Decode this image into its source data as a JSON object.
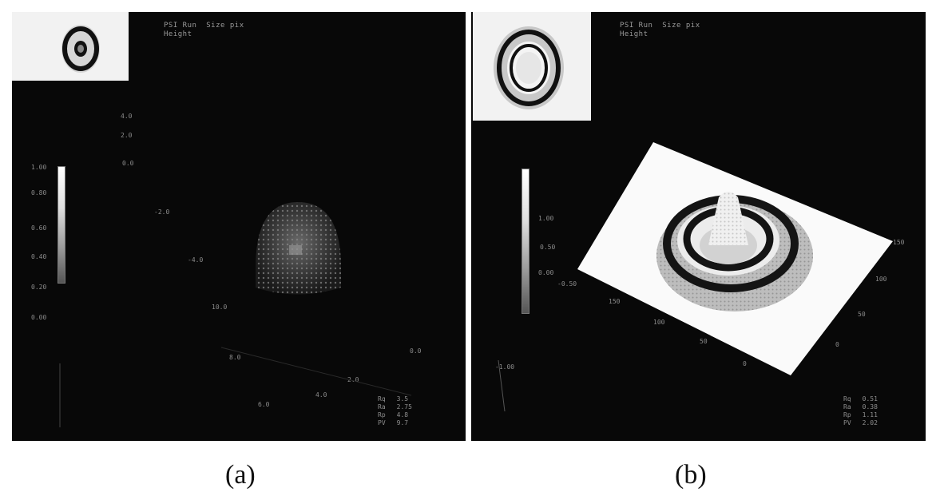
{
  "captions": {
    "a": "(a)",
    "b": "(b)"
  },
  "panel_a": {
    "header_line1": "PSI Run  Size pix",
    "header_line2": "Height",
    "axis_ticks": [
      "1.00",
      "0.80",
      "0.60",
      "0.40",
      "0.20",
      "0.00",
      "4.0",
      "2.0",
      "0.0",
      "-2.0",
      "-4.0",
      "10.0",
      "8.0",
      "6.0",
      "4.0",
      "2.0",
      "0.0"
    ],
    "stats": [
      {
        "label": "Rq",
        "value": "3.5"
      },
      {
        "label": "Ra",
        "value": "2.75"
      },
      {
        "label": "Rp",
        "value": "4.8"
      },
      {
        "label": "PV",
        "value": "9.7"
      }
    ]
  },
  "panel_b": {
    "header_line1": "PSI Run  Size pix",
    "header_line2": "Height",
    "axis_ticks": [
      "1.00",
      "0.50",
      "0.00",
      "-0.50",
      "-1.00",
      "150",
      "100",
      "50",
      "0",
      "150",
      "100",
      "50",
      "0"
    ],
    "stats": [
      {
        "label": "Rq",
        "value": "0.51"
      },
      {
        "label": "Ra",
        "value": "0.38"
      },
      {
        "label": "Rp",
        "value": "1.11"
      },
      {
        "label": "PV",
        "value": "2.02"
      }
    ]
  },
  "colors": {
    "background": "#080808",
    "surface": "#fafafa",
    "ring": "#141414"
  }
}
